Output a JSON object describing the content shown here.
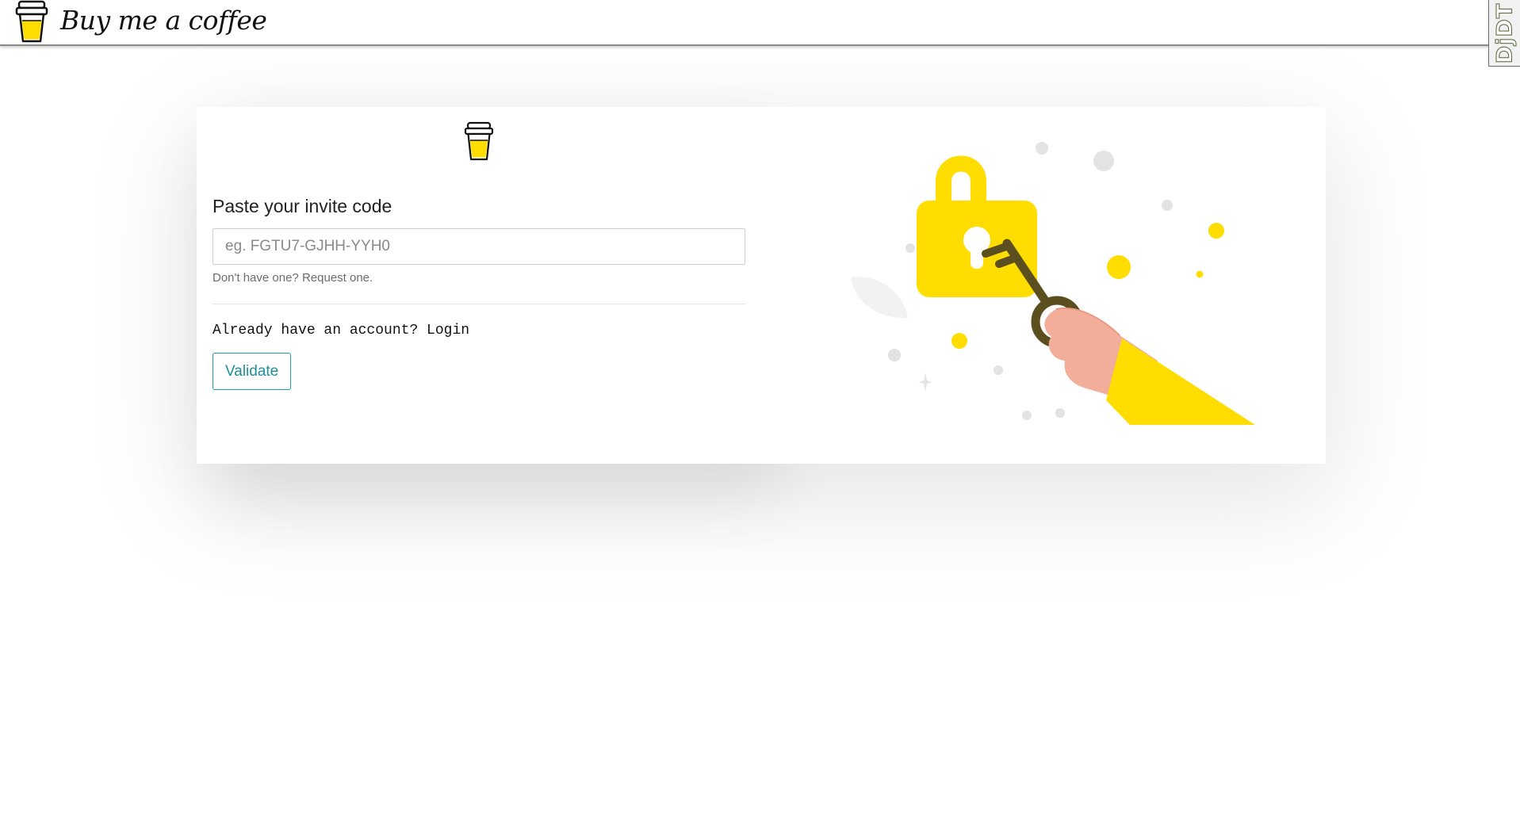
{
  "header": {
    "brand_name": "Buy me a coffee",
    "logo_icon": "coffee-cup-icon"
  },
  "debug_toolbar": {
    "label": "DjDT"
  },
  "invite": {
    "heading": "Paste your invite code",
    "input_placeholder": "eg. FGTU7-GJHH-YYH0",
    "input_value": "",
    "helper_prefix": "Don't have one? ",
    "helper_link": "Request one.",
    "login_prefix": "Already have an account? ",
    "login_link": "Login",
    "validate_label": "Validate"
  },
  "illustration": {
    "icons": [
      "padlock-icon",
      "key-icon",
      "hand-icon"
    ]
  },
  "colors": {
    "accent_yellow": "#FFDD00",
    "key_olive": "#5C4F1F",
    "skin": "#F2AE9A",
    "button_teal": "#1F9AA8"
  }
}
